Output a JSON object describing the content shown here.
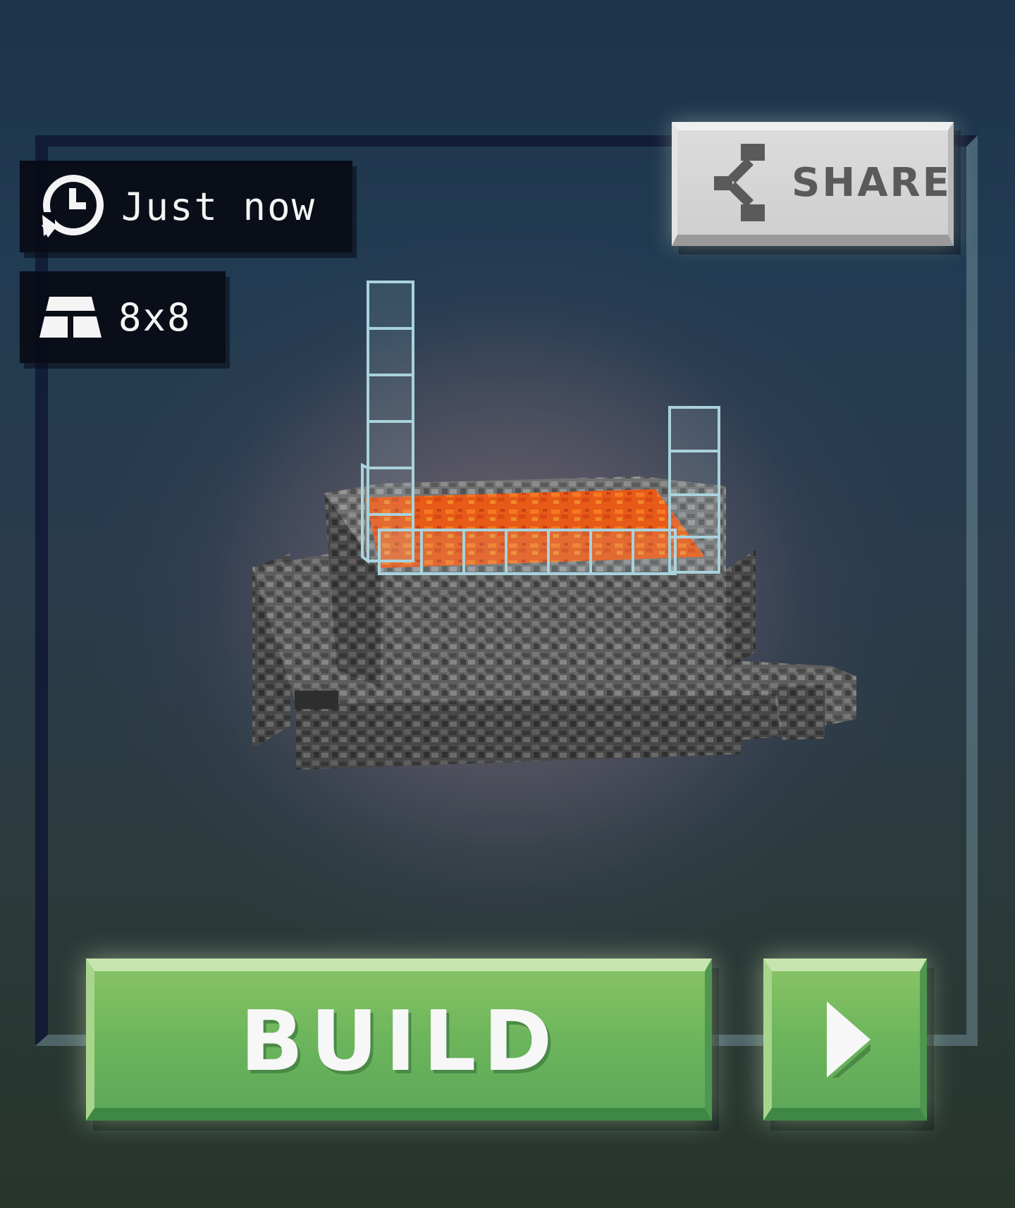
{
  "preview": {
    "time_label": "Just now",
    "size_label": "8x8",
    "time_icon": "history-clock-icon",
    "size_icon": "grid-area-icon"
  },
  "share": {
    "label": "SHARE",
    "icon": "share-icon"
  },
  "actions": {
    "build_label": "BUILD",
    "play_icon": "play-arrow-icon"
  },
  "colors": {
    "build_green": "#6cb55c",
    "share_gray": "#d6d6d6",
    "lava_orange": "#f0651b",
    "stone_gray": "#5b5b5b"
  }
}
